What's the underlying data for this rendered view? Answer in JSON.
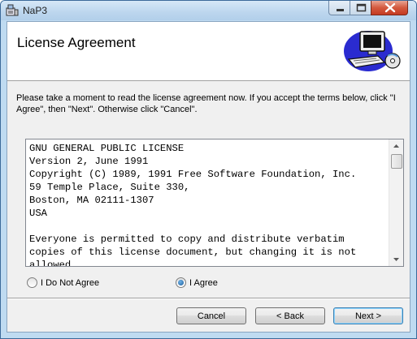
{
  "window": {
    "title": "NaP3",
    "icon": "installer-icon"
  },
  "header": {
    "title": "License Agreement",
    "art_icon": "computer-setup-icon"
  },
  "instructions": "Please take a moment to read the license agreement now. If you accept the terms below, click \"I Agree\", then \"Next\". Otherwise click \"Cancel\".",
  "license": {
    "lines": [
      "GNU GENERAL PUBLIC LICENSE",
      "Version 2, June 1991",
      "Copyright (C) 1989, 1991 Free Software Foundation, Inc.",
      "59 Temple Place, Suite 330,",
      "Boston, MA 02111-1307",
      "USA",
      "",
      "Everyone is permitted to copy and distribute verbatim",
      "copies of this license document, but changing it is not",
      "allowed."
    ]
  },
  "options": {
    "disagree_label": "I Do Not Agree",
    "agree_label": "I Agree",
    "selected": "agree"
  },
  "buttons": {
    "cancel": "Cancel",
    "back": "< Back",
    "next": "Next >"
  }
}
